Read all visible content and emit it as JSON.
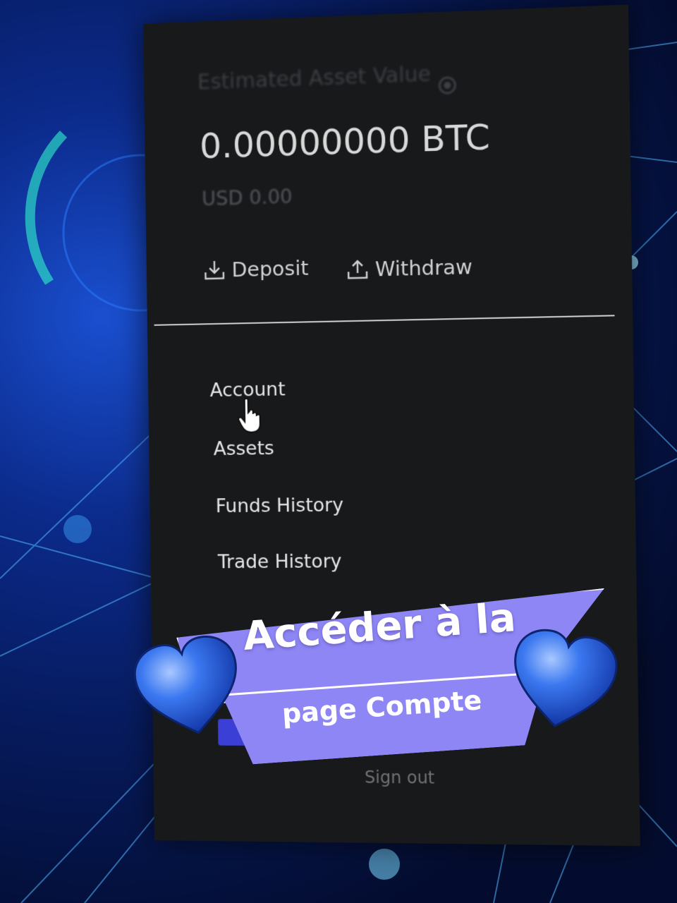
{
  "wallet": {
    "asset_label": "Estimated Asset Value",
    "balance": "0.00000000 BTC",
    "usd_value": "USD 0.00",
    "deposit_label": "Deposit",
    "withdraw_label": "Withdraw"
  },
  "menu": {
    "items": [
      {
        "label": "Account"
      },
      {
        "label": "Assets"
      },
      {
        "label": "Funds History"
      },
      {
        "label": "Trade History"
      }
    ],
    "signout_label": "Sign out"
  },
  "overlay": {
    "title": "Accéder à la",
    "subtitle": "page Compte",
    "accent_color": "#8d86f4",
    "heart_color": "#2f6be8"
  }
}
